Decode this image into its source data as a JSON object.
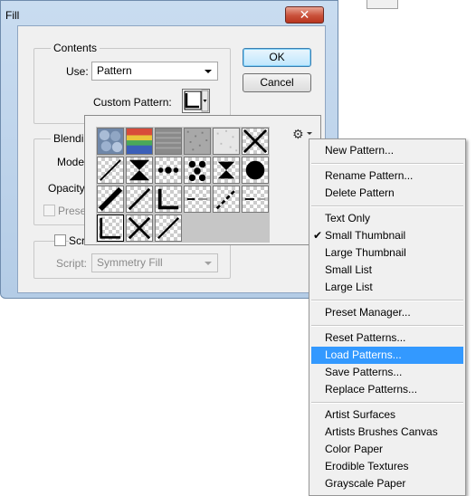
{
  "dialog": {
    "title": "Fill",
    "close_label": "✕",
    "ok_label": "OK",
    "cancel_label": "Cancel",
    "contents": {
      "legend": "Contents",
      "use_label": "Use:",
      "use_value": "Pattern",
      "custom_pattern_label": "Custom Pattern:"
    },
    "blending": {
      "legend_partial": "Blendi",
      "mode_partial": "Mode",
      "opacity_partial": "Opacity",
      "preserve_partial": "Prese"
    },
    "script": {
      "checkbox_partial": "Scr",
      "script_label": "Script:",
      "script_value": "Symmetry Fill"
    }
  },
  "picker": {
    "gear_icon": "gear-icon",
    "patterns": [
      "bubbles",
      "tie-dye",
      "gray-granite",
      "gray-noise",
      "white-noise",
      "x-diagonals",
      "thin-diagonal",
      "hourglass-diamond",
      "dot-row",
      "dots-cluster",
      "hourglass-alt",
      "big-dot",
      "thick-diagonal",
      "diagonal-lines",
      "corner-l",
      "dash-line",
      "diagonal-dots",
      "dash-short",
      "corner-frame",
      "x-cross",
      "diagonal-single"
    ],
    "selected_index": 18
  },
  "menu": {
    "items": [
      {
        "label": "New Pattern...",
        "checked": false,
        "highlight": false
      },
      {
        "label": "Rename Pattern...",
        "checked": false,
        "highlight": false
      },
      {
        "label": "Delete Pattern",
        "checked": false,
        "highlight": false
      },
      {
        "label": "Text Only",
        "checked": false,
        "highlight": false
      },
      {
        "label": "Small Thumbnail",
        "checked": true,
        "highlight": false
      },
      {
        "label": "Large Thumbnail",
        "checked": false,
        "highlight": false
      },
      {
        "label": "Small List",
        "checked": false,
        "highlight": false
      },
      {
        "label": "Large List",
        "checked": false,
        "highlight": false
      },
      {
        "label": "Preset Manager...",
        "checked": false,
        "highlight": false
      },
      {
        "label": "Reset Patterns...",
        "checked": false,
        "highlight": false
      },
      {
        "label": "Load Patterns...",
        "checked": false,
        "highlight": true
      },
      {
        "label": "Save Patterns...",
        "checked": false,
        "highlight": false
      },
      {
        "label": "Replace Patterns...",
        "checked": false,
        "highlight": false
      },
      {
        "label": "Artist Surfaces",
        "checked": false,
        "highlight": false
      },
      {
        "label": "Artists Brushes Canvas",
        "checked": false,
        "highlight": false
      },
      {
        "label": "Color Paper",
        "checked": false,
        "highlight": false
      },
      {
        "label": "Erodible Textures",
        "checked": false,
        "highlight": false
      },
      {
        "label": "Grayscale Paper",
        "checked": false,
        "highlight": false
      }
    ],
    "check_glyph": "✔"
  },
  "colors": {
    "highlight": "#3399ff",
    "close_button": "#c9513a"
  }
}
